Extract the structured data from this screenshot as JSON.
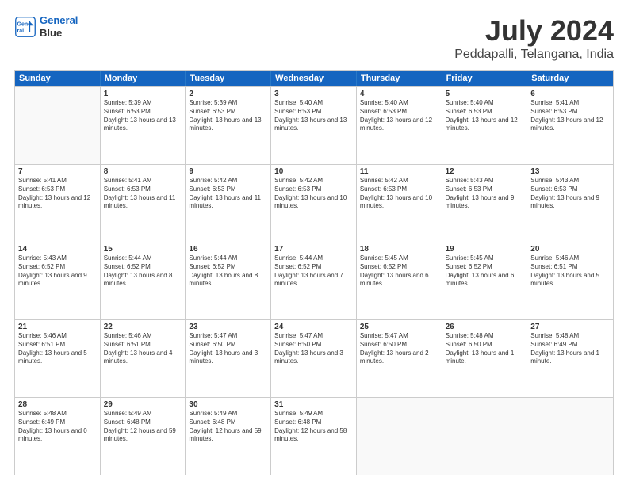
{
  "header": {
    "logo_line1": "General",
    "logo_line2": "Blue",
    "main_title": "July 2024",
    "subtitle": "Peddapalli, Telangana, India"
  },
  "days_of_week": [
    "Sunday",
    "Monday",
    "Tuesday",
    "Wednesday",
    "Thursday",
    "Friday",
    "Saturday"
  ],
  "weeks": [
    [
      {
        "day": "",
        "empty": true
      },
      {
        "day": "1",
        "sunrise": "Sunrise: 5:39 AM",
        "sunset": "Sunset: 6:53 PM",
        "daylight": "Daylight: 13 hours and 13 minutes."
      },
      {
        "day": "2",
        "sunrise": "Sunrise: 5:39 AM",
        "sunset": "Sunset: 6:53 PM",
        "daylight": "Daylight: 13 hours and 13 minutes."
      },
      {
        "day": "3",
        "sunrise": "Sunrise: 5:40 AM",
        "sunset": "Sunset: 6:53 PM",
        "daylight": "Daylight: 13 hours and 13 minutes."
      },
      {
        "day": "4",
        "sunrise": "Sunrise: 5:40 AM",
        "sunset": "Sunset: 6:53 PM",
        "daylight": "Daylight: 13 hours and 12 minutes."
      },
      {
        "day": "5",
        "sunrise": "Sunrise: 5:40 AM",
        "sunset": "Sunset: 6:53 PM",
        "daylight": "Daylight: 13 hours and 12 minutes."
      },
      {
        "day": "6",
        "sunrise": "Sunrise: 5:41 AM",
        "sunset": "Sunset: 6:53 PM",
        "daylight": "Daylight: 13 hours and 12 minutes."
      }
    ],
    [
      {
        "day": "7",
        "sunrise": "Sunrise: 5:41 AM",
        "sunset": "Sunset: 6:53 PM",
        "daylight": "Daylight: 13 hours and 12 minutes."
      },
      {
        "day": "8",
        "sunrise": "Sunrise: 5:41 AM",
        "sunset": "Sunset: 6:53 PM",
        "daylight": "Daylight: 13 hours and 11 minutes."
      },
      {
        "day": "9",
        "sunrise": "Sunrise: 5:42 AM",
        "sunset": "Sunset: 6:53 PM",
        "daylight": "Daylight: 13 hours and 11 minutes."
      },
      {
        "day": "10",
        "sunrise": "Sunrise: 5:42 AM",
        "sunset": "Sunset: 6:53 PM",
        "daylight": "Daylight: 13 hours and 10 minutes."
      },
      {
        "day": "11",
        "sunrise": "Sunrise: 5:42 AM",
        "sunset": "Sunset: 6:53 PM",
        "daylight": "Daylight: 13 hours and 10 minutes."
      },
      {
        "day": "12",
        "sunrise": "Sunrise: 5:43 AM",
        "sunset": "Sunset: 6:53 PM",
        "daylight": "Daylight: 13 hours and 9 minutes."
      },
      {
        "day": "13",
        "sunrise": "Sunrise: 5:43 AM",
        "sunset": "Sunset: 6:53 PM",
        "daylight": "Daylight: 13 hours and 9 minutes."
      }
    ],
    [
      {
        "day": "14",
        "sunrise": "Sunrise: 5:43 AM",
        "sunset": "Sunset: 6:52 PM",
        "daylight": "Daylight: 13 hours and 9 minutes."
      },
      {
        "day": "15",
        "sunrise": "Sunrise: 5:44 AM",
        "sunset": "Sunset: 6:52 PM",
        "daylight": "Daylight: 13 hours and 8 minutes."
      },
      {
        "day": "16",
        "sunrise": "Sunrise: 5:44 AM",
        "sunset": "Sunset: 6:52 PM",
        "daylight": "Daylight: 13 hours and 8 minutes."
      },
      {
        "day": "17",
        "sunrise": "Sunrise: 5:44 AM",
        "sunset": "Sunset: 6:52 PM",
        "daylight": "Daylight: 13 hours and 7 minutes."
      },
      {
        "day": "18",
        "sunrise": "Sunrise: 5:45 AM",
        "sunset": "Sunset: 6:52 PM",
        "daylight": "Daylight: 13 hours and 6 minutes."
      },
      {
        "day": "19",
        "sunrise": "Sunrise: 5:45 AM",
        "sunset": "Sunset: 6:52 PM",
        "daylight": "Daylight: 13 hours and 6 minutes."
      },
      {
        "day": "20",
        "sunrise": "Sunrise: 5:46 AM",
        "sunset": "Sunset: 6:51 PM",
        "daylight": "Daylight: 13 hours and 5 minutes."
      }
    ],
    [
      {
        "day": "21",
        "sunrise": "Sunrise: 5:46 AM",
        "sunset": "Sunset: 6:51 PM",
        "daylight": "Daylight: 13 hours and 5 minutes."
      },
      {
        "day": "22",
        "sunrise": "Sunrise: 5:46 AM",
        "sunset": "Sunset: 6:51 PM",
        "daylight": "Daylight: 13 hours and 4 minutes."
      },
      {
        "day": "23",
        "sunrise": "Sunrise: 5:47 AM",
        "sunset": "Sunset: 6:50 PM",
        "daylight": "Daylight: 13 hours and 3 minutes."
      },
      {
        "day": "24",
        "sunrise": "Sunrise: 5:47 AM",
        "sunset": "Sunset: 6:50 PM",
        "daylight": "Daylight: 13 hours and 3 minutes."
      },
      {
        "day": "25",
        "sunrise": "Sunrise: 5:47 AM",
        "sunset": "Sunset: 6:50 PM",
        "daylight": "Daylight: 13 hours and 2 minutes."
      },
      {
        "day": "26",
        "sunrise": "Sunrise: 5:48 AM",
        "sunset": "Sunset: 6:50 PM",
        "daylight": "Daylight: 13 hours and 1 minute."
      },
      {
        "day": "27",
        "sunrise": "Sunrise: 5:48 AM",
        "sunset": "Sunset: 6:49 PM",
        "daylight": "Daylight: 13 hours and 1 minute."
      }
    ],
    [
      {
        "day": "28",
        "sunrise": "Sunrise: 5:48 AM",
        "sunset": "Sunset: 6:49 PM",
        "daylight": "Daylight: 13 hours and 0 minutes."
      },
      {
        "day": "29",
        "sunrise": "Sunrise: 5:49 AM",
        "sunset": "Sunset: 6:48 PM",
        "daylight": "Daylight: 12 hours and 59 minutes."
      },
      {
        "day": "30",
        "sunrise": "Sunrise: 5:49 AM",
        "sunset": "Sunset: 6:48 PM",
        "daylight": "Daylight: 12 hours and 59 minutes."
      },
      {
        "day": "31",
        "sunrise": "Sunrise: 5:49 AM",
        "sunset": "Sunset: 6:48 PM",
        "daylight": "Daylight: 12 hours and 58 minutes."
      },
      {
        "day": "",
        "empty": true
      },
      {
        "day": "",
        "empty": true
      },
      {
        "day": "",
        "empty": true
      }
    ]
  ]
}
